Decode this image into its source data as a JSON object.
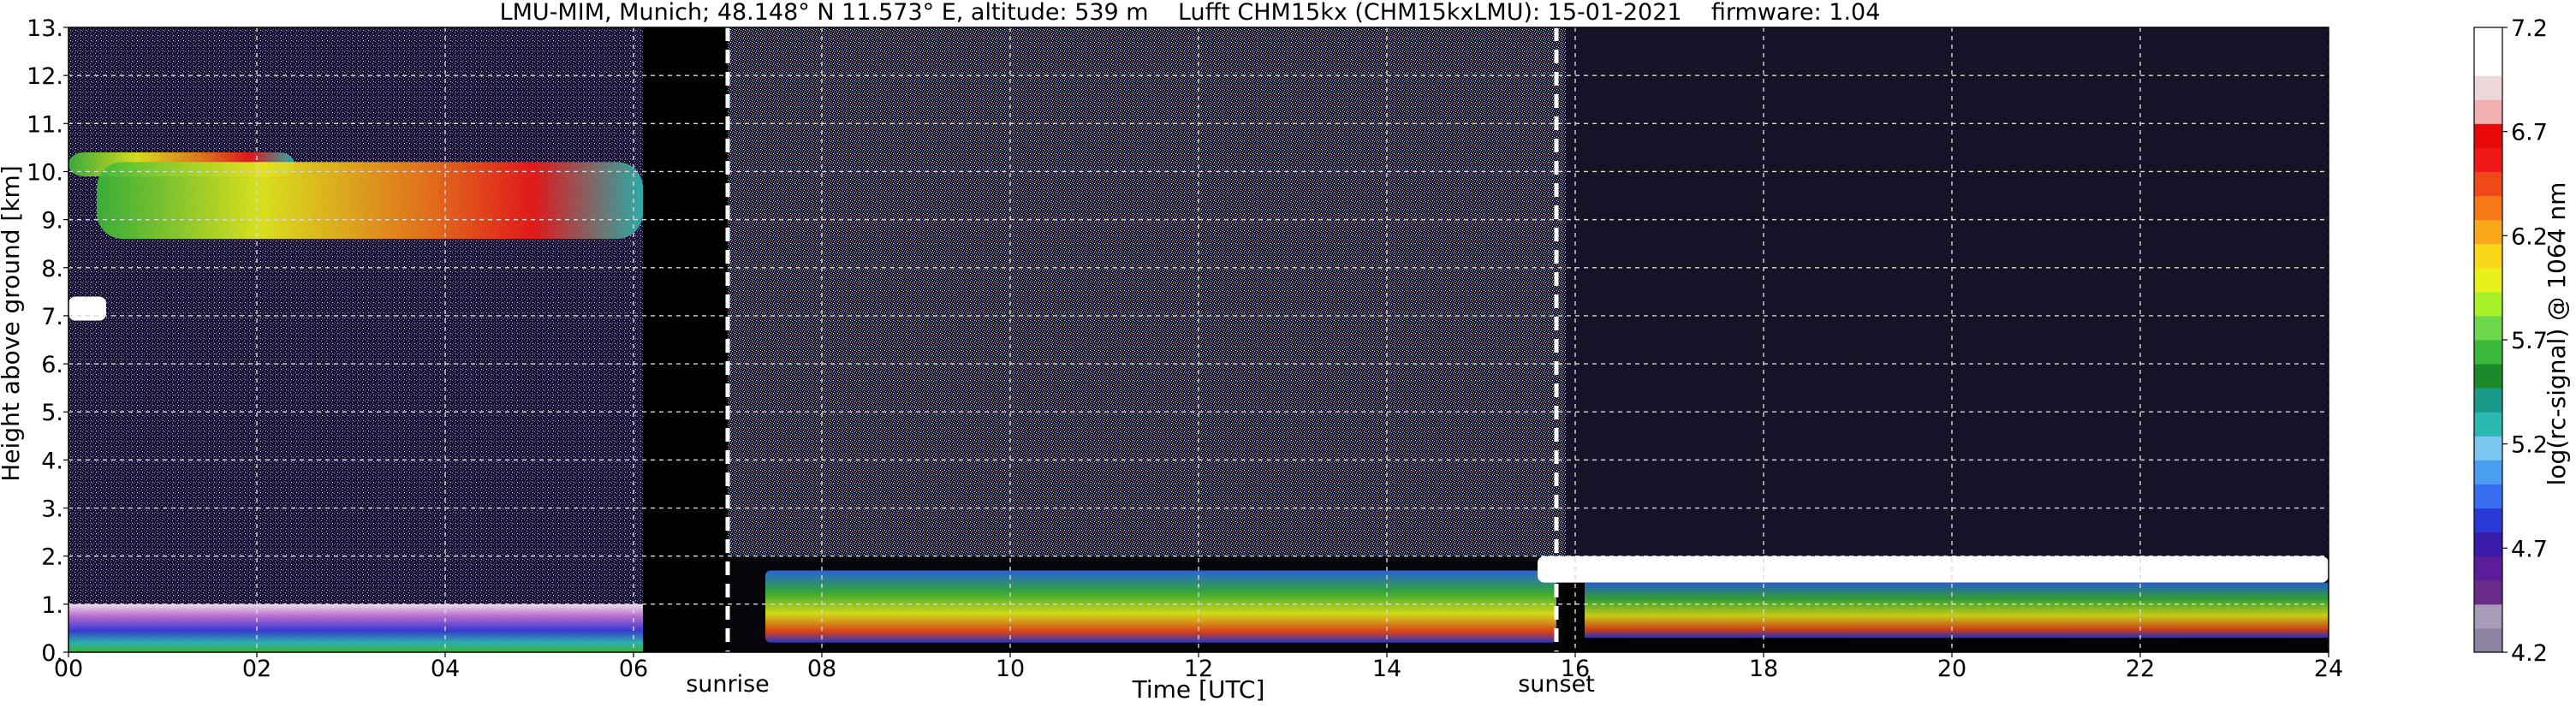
{
  "chart_data": {
    "type": "heatmap",
    "title": "LMU-MIM, Munich; 48.148° N 11.573° E, altitude: 539 m    Lufft CHM15kx (CHM15kxLMU): 15-01-2021    firmware: 1.04",
    "xlabel": "Time [UTC]",
    "ylabel": "Height above ground [km]",
    "xlim": [
      0,
      24
    ],
    "ylim": [
      0,
      13
    ],
    "x_tick_labels": [
      "00",
      "02",
      "04",
      "06",
      "08",
      "10",
      "12",
      "14",
      "16",
      "18",
      "20",
      "22",
      "24"
    ],
    "y_tick_labels": [
      "0.",
      "1.",
      "2.",
      "3.",
      "4.",
      "5.",
      "6.",
      "7.",
      "8.",
      "9.",
      "10.",
      "11.",
      "12.",
      "13."
    ],
    "grid": true,
    "background_color": "#1b1533",
    "colorbar": {
      "label": "log(rc-signal) @ 1064 nm",
      "tick_labels": [
        "4.2",
        "4.7",
        "5.2",
        "5.7",
        "6.2",
        "6.7",
        "7.2"
      ],
      "range": [
        4.2,
        7.2
      ],
      "colors": [
        "#8d82a0",
        "#a89bb8",
        "#6a2a8a",
        "#5a1e9a",
        "#3a1aa8",
        "#2a3ad8",
        "#3a6ef0",
        "#4a9ef0",
        "#7ac8f0",
        "#2ab8b0",
        "#1a9a8a",
        "#1a8a2a",
        "#3ab83a",
        "#6ad84a",
        "#a8f02a",
        "#e8f01a",
        "#f8d818",
        "#f8a818",
        "#f87818",
        "#f04818",
        "#f01818",
        "#e80808",
        "#f0b0b0",
        "#ecd8d8",
        "#ffffff",
        "#ffffff"
      ]
    },
    "annotations": [
      {
        "text": "sunrise",
        "x": 7.0
      },
      {
        "text": "sunset",
        "x": 15.8
      }
    ],
    "features": [
      {
        "name": "cirrus-upper",
        "x": [
          0.0,
          2.4
        ],
        "y": [
          9.9,
          10.4
        ],
        "level": 5.9
      },
      {
        "name": "cirrus-lower",
        "x": [
          0.3,
          6.1
        ],
        "y": [
          8.6,
          10.2
        ],
        "level": 6.0
      },
      {
        "name": "thin-layer",
        "x": [
          0.0,
          0.4
        ],
        "y": [
          6.9,
          7.4
        ],
        "level": 6.7
      },
      {
        "name": "boundary-layer-night",
        "x": [
          0.0,
          6.1
        ],
        "y": [
          0.0,
          1.0
        ],
        "level": 4.6
      },
      {
        "name": "boundary-layer-day",
        "x": [
          7.4,
          15.8
        ],
        "y": [
          0.2,
          1.7
        ],
        "level": 5.6
      },
      {
        "name": "cloud-top-evening",
        "x": [
          15.6,
          24.0
        ],
        "y": [
          0.3,
          2.0
        ],
        "level": 6.9
      }
    ]
  }
}
